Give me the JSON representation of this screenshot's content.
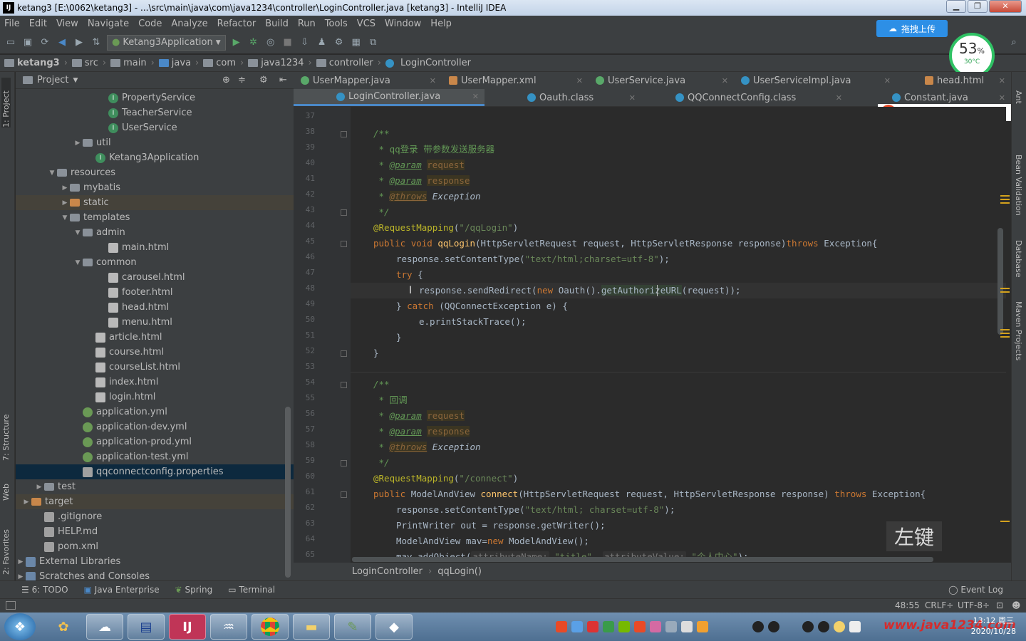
{
  "window": {
    "title": "ketang3 [E:\\0062\\ketang3] - ...\\src\\main\\java\\com\\java1234\\controller\\LoginController.java [ketang3] - IntelliJ IDEA",
    "ij": "IJ",
    "min": "▁",
    "max": "❐",
    "close": "✕"
  },
  "menu": [
    "File",
    "Edit",
    "View",
    "Navigate",
    "Code",
    "Analyze",
    "Refactor",
    "Build",
    "Run",
    "Tools",
    "VCS",
    "Window",
    "Help"
  ],
  "toolbar": {
    "run_config": "Ketang3Application"
  },
  "upload_label": "拖拽上传",
  "gauge": {
    "percent": "53",
    "unit": "%",
    "temp": "30°C",
    "level": 0.53
  },
  "navbar": [
    "ketang3",
    "src",
    "main",
    "java",
    "com",
    "java1234",
    "controller",
    "LoginController"
  ],
  "project": {
    "title": "Project",
    "rows": [
      {
        "label": "PropertyService",
        "indent": 130,
        "icon": "cls",
        "arrow": ""
      },
      {
        "label": "TeacherService",
        "indent": 130,
        "icon": "cls",
        "arrow": ""
      },
      {
        "label": "UserService",
        "indent": 130,
        "icon": "cls",
        "arrow": ""
      },
      {
        "label": "util",
        "indent": 94,
        "icon": "fold",
        "arrow": "▶"
      },
      {
        "label": "Ketang3Application",
        "indent": 112,
        "icon": "cls",
        "arrow": ""
      },
      {
        "label": "resources",
        "indent": 58,
        "icon": "fold",
        "arrow": "▼"
      },
      {
        "label": "mybatis",
        "indent": 76,
        "icon": "fold",
        "arrow": "▶"
      },
      {
        "label": "static",
        "indent": 76,
        "icon": "foldo",
        "arrow": "▶"
      },
      {
        "label": "templates",
        "indent": 76,
        "icon": "fold",
        "arrow": "▼"
      },
      {
        "label": "admin",
        "indent": 94,
        "icon": "fold",
        "arrow": "▼"
      },
      {
        "label": "main.html",
        "indent": 130,
        "icon": "html",
        "arrow": ""
      },
      {
        "label": "common",
        "indent": 94,
        "icon": "fold",
        "arrow": "▼"
      },
      {
        "label": "carousel.html",
        "indent": 130,
        "icon": "html",
        "arrow": ""
      },
      {
        "label": "footer.html",
        "indent": 130,
        "icon": "html",
        "arrow": ""
      },
      {
        "label": "head.html",
        "indent": 130,
        "icon": "html",
        "arrow": ""
      },
      {
        "label": "menu.html",
        "indent": 130,
        "icon": "html",
        "arrow": ""
      },
      {
        "label": "article.html",
        "indent": 112,
        "icon": "html",
        "arrow": ""
      },
      {
        "label": "course.html",
        "indent": 112,
        "icon": "html",
        "arrow": ""
      },
      {
        "label": "courseList.html",
        "indent": 112,
        "icon": "html",
        "arrow": ""
      },
      {
        "label": "index.html",
        "indent": 112,
        "icon": "html",
        "arrow": ""
      },
      {
        "label": "login.html",
        "indent": 112,
        "icon": "html",
        "arrow": ""
      },
      {
        "label": "application.yml",
        "indent": 94,
        "icon": "yml",
        "arrow": ""
      },
      {
        "label": "application-dev.yml",
        "indent": 94,
        "icon": "yml",
        "arrow": ""
      },
      {
        "label": "application-prod.yml",
        "indent": 94,
        "icon": "yml",
        "arrow": ""
      },
      {
        "label": "application-test.yml",
        "indent": 94,
        "icon": "yml",
        "arrow": ""
      },
      {
        "label": "qqconnectconfig.properties",
        "indent": 94,
        "icon": "prop",
        "arrow": "",
        "sel": true
      },
      {
        "label": "test",
        "indent": 40,
        "icon": "fold",
        "arrow": "▶"
      },
      {
        "label": "target",
        "indent": 22,
        "icon": "foldo",
        "arrow": "▶"
      },
      {
        "label": ".gitignore",
        "indent": 40,
        "icon": "prop",
        "arrow": ""
      },
      {
        "label": "HELP.md",
        "indent": 40,
        "icon": "prop",
        "arrow": ""
      },
      {
        "label": "pom.xml",
        "indent": 40,
        "icon": "prop",
        "arrow": ""
      },
      {
        "label": "External Libraries",
        "indent": 4,
        "icon": "lib",
        "arrow": "▶"
      },
      {
        "label": "Scratches and Consoles",
        "indent": 4,
        "icon": "lib",
        "arrow": "▶"
      }
    ]
  },
  "tabs_row1": [
    "UserMapper.java",
    "UserMapper.xml",
    "UserService.java",
    "UserServiceImpl.java",
    "head.html"
  ],
  "tabs_row2": [
    "LoginController.java",
    "Oauth.class",
    "QQConnectConfig.class",
    "Constant.java"
  ],
  "ime": {
    "lang": "英"
  },
  "line_numbers": [
    "37",
    "38",
    "39",
    "40",
    "41",
    "42",
    "43",
    "44",
    "45",
    "46",
    "47",
    "48",
    "49",
    "50",
    "51",
    "52",
    "53",
    "54",
    "55",
    "56",
    "57",
    "58",
    "59",
    "60",
    "61",
    "62",
    "63",
    "64",
    "65"
  ],
  "code": {
    "l38": "/**",
    "l39_star": " * ",
    "l39": "qq登录 带参数发送服务器",
    "star": " * ",
    "param": "@param",
    "request": "request",
    "response": "response",
    "throws": "@throws",
    "exception": " Exception",
    "close": " */",
    "l44_ann": "@RequestMapping",
    "l44_a": "(",
    "l44_str": "\"/qqLogin\"",
    "l44_b": ")",
    "public": "public ",
    "void": "void ",
    "qqLogin": "qqLogin",
    "l45_sig": "(HttpServletRequest request, HttpServletResponse response)",
    "throws_kw": "throws",
    "l45_end": " Exception{",
    "l46_a": "response.setContentType(",
    "l46_str": "\"text/html;charset=utf-8\"",
    "l46_b": ");",
    "try": "try",
    "l47_b": " {",
    "l48_a": "response.sendRedirect(",
    "new": "new ",
    "l48_b": "Oauth().",
    "l48_fn": "getAuthorizeURL",
    "l48_c": "(request));",
    "l49_a": "} ",
    "catch": "catch",
    "l49_b": " (QQConnectException e) {",
    "l50": "e.printStackTrace();",
    "l51": "}",
    "l52": "}",
    "l55": "回调",
    "l60_str": "\"/connect\"",
    "mav": "ModelAndView ",
    "connect": "connect",
    "l61_sig": "(HttpServletRequest request, HttpServletResponse response) ",
    "l61_end": " Exception{",
    "l62_str": "\"text/html; charset=utf-8\"",
    "l63": "PrintWriter out = response.getWriter();",
    "l64_a": "ModelAndView mav=",
    "l64_b": "ModelAndView();",
    "l65_a": "mav.addObject(",
    "hint1": "attributeName:",
    "l65_s1": "\"title\"",
    "comma": ", ",
    "hint2": "attributeValue:",
    "l65_s2": "\"个人中心\"",
    "l65_b": ");"
  },
  "breadcrumb": {
    "class": "LoginController",
    "method": "qqLogin()"
  },
  "key_hint": "左键",
  "left_strip": [
    "1: Project",
    "7: Structure",
    "Web",
    "2: Favorites"
  ],
  "right_strip": [
    "Ant",
    "Bean Validation",
    "Database",
    "Maven Projects"
  ],
  "bottom_tools": [
    "6: TODO",
    "Java Enterprise",
    "Spring",
    "Terminal"
  ],
  "event_log": "Event Log",
  "status": {
    "position": "48:55",
    "line_sep": "CRLF÷",
    "encoding": "UTF-8÷"
  },
  "clock": {
    "time": "13:12 周三",
    "date": "2020/10/28"
  },
  "watermark": "www.java1234.com",
  "colors": {
    "keyword": "#cc7832",
    "string": "#6a8759",
    "comment": "#629755",
    "annotation": "#bbb529",
    "function": "#ffc66d",
    "selection": "#0d293e"
  }
}
